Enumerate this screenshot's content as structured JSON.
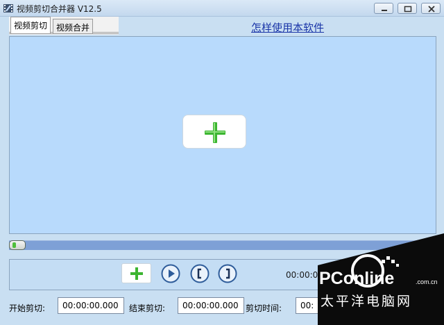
{
  "window": {
    "title": "视频剪切合并器 V12.5"
  },
  "tabs": [
    {
      "label": "视频剪切",
      "active": true
    },
    {
      "label": "视频合并",
      "active": false
    }
  ],
  "help_link": "怎样使用本软件",
  "icons": {
    "add": "plus-icon",
    "play": "play-icon",
    "mark_in": "bracket-left-icon",
    "mark_out": "bracket-right-icon",
    "minimize": "minimize-icon",
    "maximize": "maximize-icon",
    "close": "close-icon"
  },
  "colors": {
    "accent_green": "#3cb531",
    "preview_bg": "#b8dafc",
    "link": "#1a35a8"
  },
  "controls": {
    "current_time": "00:00:00"
  },
  "fields": {
    "start_label": "开始剪切:",
    "start_value": "00:00:00.000",
    "end_label": "结束剪切:",
    "end_value": "00:00:00.000",
    "duration_label": "剪切时间:",
    "duration_value": "00:"
  },
  "watermark": {
    "brand": "PConline",
    "domain": ".com.cn",
    "chinese": "太平洋电脑网"
  },
  "progress": {
    "position": 0
  }
}
